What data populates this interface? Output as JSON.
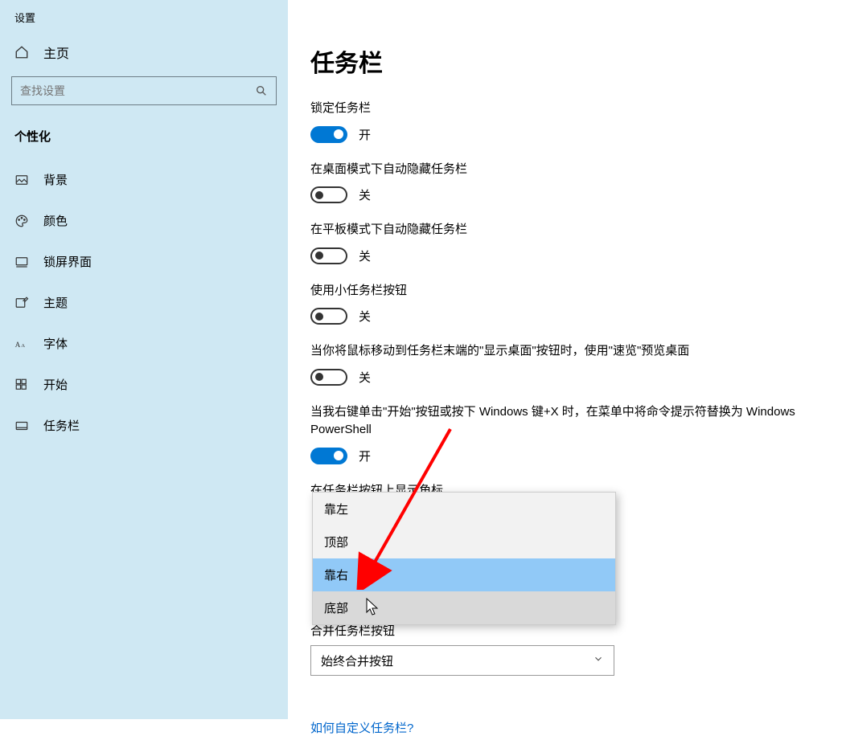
{
  "app_title": "设置",
  "home_label": "主页",
  "search_placeholder": "查找设置",
  "section_title": "个性化",
  "sidebar": {
    "items": [
      {
        "label": "背景"
      },
      {
        "label": "颜色"
      },
      {
        "label": "锁屏界面"
      },
      {
        "label": "主题"
      },
      {
        "label": "字体"
      },
      {
        "label": "开始"
      },
      {
        "label": "任务栏"
      }
    ]
  },
  "main": {
    "title": "任务栏",
    "settings": [
      {
        "label": "锁定任务栏",
        "on": true,
        "text_on": "开"
      },
      {
        "label": "在桌面模式下自动隐藏任务栏",
        "on": false,
        "text_off": "关"
      },
      {
        "label": "在平板模式下自动隐藏任务栏",
        "on": false,
        "text_off": "关"
      },
      {
        "label": "使用小任务栏按钮",
        "on": false,
        "text_off": "关"
      },
      {
        "label": "当你将鼠标移动到任务栏末端的\"显示桌面\"按钮时，使用\"速览\"预览桌面",
        "on": false,
        "text_off": "关"
      },
      {
        "label": "当我右键单击\"开始\"按钮或按下 Windows 键+X 时，在菜单中将命令提示符替换为 Windows PowerShell",
        "on": true,
        "text_on": "开"
      }
    ],
    "badge_label": "在任务栏按钮上显示角标",
    "dropdown_options": [
      "靠左",
      "顶部",
      "靠右",
      "底部"
    ],
    "combine_label": "合并任务栏按钮",
    "combine_value": "始终合并按钮",
    "help_link": "如何自定义任务栏?"
  },
  "toggle_text": {
    "on": "开",
    "off": "关"
  }
}
